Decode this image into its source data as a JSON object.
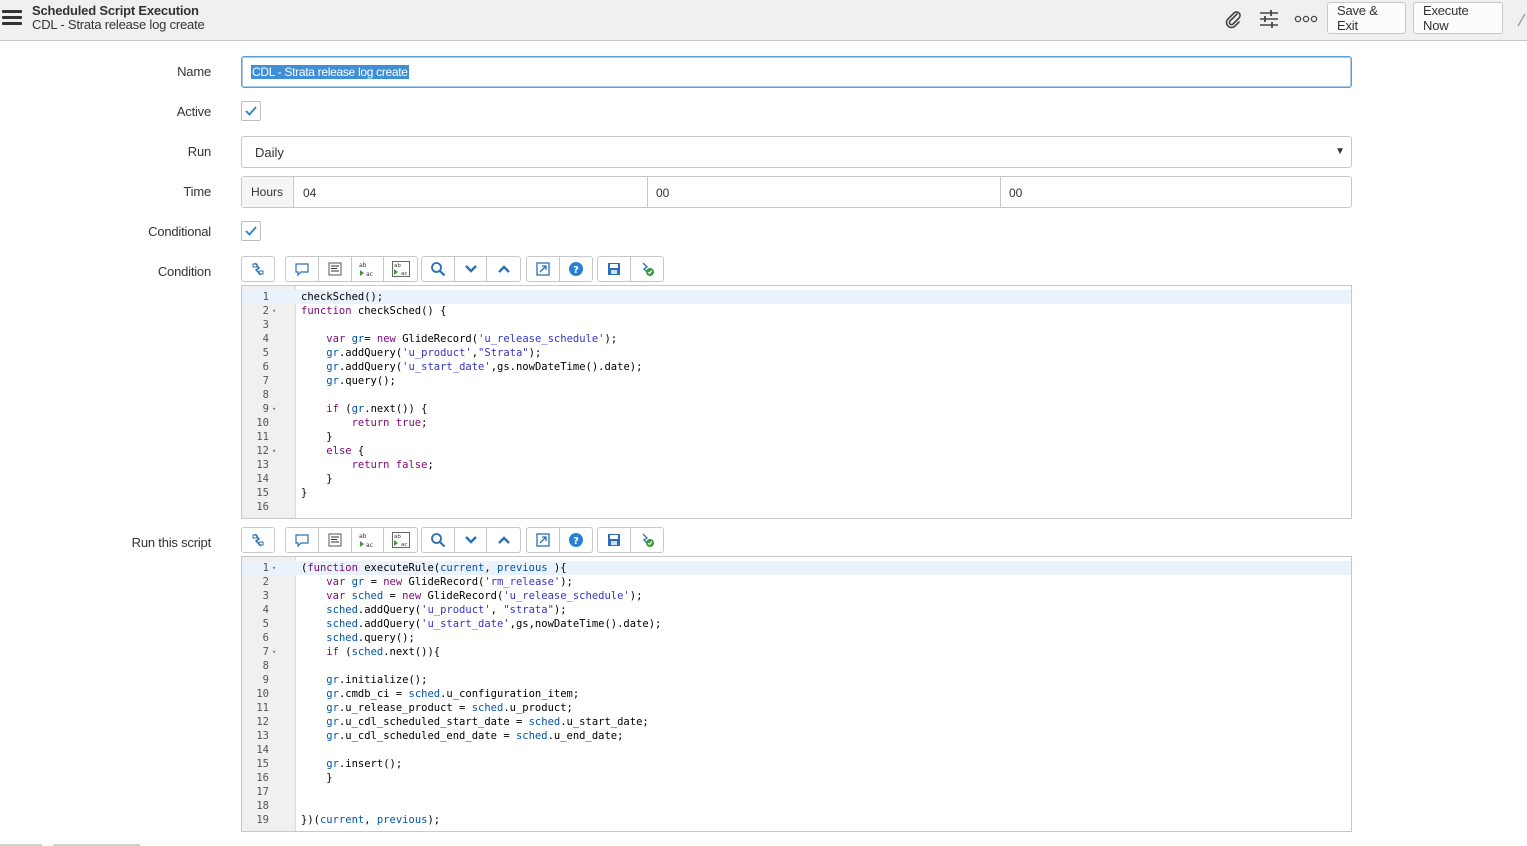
{
  "header": {
    "title": "Scheduled Script Execution",
    "subtitle": "CDL - Strata release log create",
    "buttons": {
      "save_exit": "Save & Exit",
      "execute_now": "Execute Now"
    },
    "icons": [
      "menu-icon",
      "paperclip-icon",
      "sliders-icon",
      "more-icon"
    ]
  },
  "form": {
    "name": {
      "label": "Name",
      "value": "CDL - Strata release log create"
    },
    "active": {
      "label": "Active",
      "checked": true
    },
    "run": {
      "label": "Run",
      "value": "Daily"
    },
    "time": {
      "label": "Time",
      "addon": "Hours",
      "hours": "04",
      "minutes": "00",
      "seconds": "00"
    },
    "conditional": {
      "label": "Conditional",
      "checked": true
    },
    "condition": {
      "label": "Condition"
    },
    "script": {
      "label": "Run this script"
    }
  },
  "toolbar_icons": [
    "toggle-syntax-icon",
    "comment-icon",
    "format-icon",
    "replace-icon",
    "replace-all-icon",
    "search-icon",
    "find-next-icon",
    "find-previous-icon",
    "fullscreen-icon",
    "help-icon",
    "save-icon",
    "script-debugger-icon"
  ],
  "condition_code": [
    {
      "n": "1",
      "fold": "",
      "text": "checkSched();"
    },
    {
      "n": "2",
      "fold": "▾",
      "text": "function checkSched() {"
    },
    {
      "n": "3",
      "fold": "",
      "text": ""
    },
    {
      "n": "4",
      "fold": "",
      "text": "    var gr= new GlideRecord('u_release_schedule');"
    },
    {
      "n": "5",
      "fold": "",
      "text": "    gr.addQuery('u_product',\"Strata\");"
    },
    {
      "n": "6",
      "fold": "",
      "text": "    gr.addQuery('u_start_date',gs.nowDateTime().date);"
    },
    {
      "n": "7",
      "fold": "",
      "text": "    gr.query();"
    },
    {
      "n": "8",
      "fold": "",
      "text": ""
    },
    {
      "n": "9",
      "fold": "▾",
      "text": "    if (gr.next()) {"
    },
    {
      "n": "10",
      "fold": "",
      "text": "        return true;"
    },
    {
      "n": "11",
      "fold": "",
      "text": "    }"
    },
    {
      "n": "12",
      "fold": "▾",
      "text": "    else {"
    },
    {
      "n": "13",
      "fold": "",
      "text": "        return false;"
    },
    {
      "n": "14",
      "fold": "",
      "text": "    }"
    },
    {
      "n": "15",
      "fold": "",
      "text": "}"
    },
    {
      "n": "16",
      "fold": "",
      "text": ""
    }
  ],
  "script_code": [
    {
      "n": "1",
      "fold": "▾",
      "text": "(function executeRule(current, previous ){"
    },
    {
      "n": "2",
      "fold": "",
      "text": "    var gr = new GlideRecord('rm_release');"
    },
    {
      "n": "3",
      "fold": "",
      "text": "    var sched = new GlideRecord('u_release_schedule');"
    },
    {
      "n": "4",
      "fold": "",
      "text": "    sched.addQuery('u_product', \"strata\");"
    },
    {
      "n": "5",
      "fold": "",
      "text": "    sched.addQuery('u_start_date',gs,nowDateTime().date);"
    },
    {
      "n": "6",
      "fold": "",
      "text": "    sched.query();"
    },
    {
      "n": "7",
      "fold": "▾",
      "text": "    if (sched.next()){"
    },
    {
      "n": "8",
      "fold": "",
      "text": ""
    },
    {
      "n": "9",
      "fold": "",
      "text": "    gr.initialize();"
    },
    {
      "n": "10",
      "fold": "",
      "text": "    gr.cmdb_ci = sched.u_configuration_item;"
    },
    {
      "n": "11",
      "fold": "",
      "text": "    gr.u_release_product = sched.u_product;"
    },
    {
      "n": "12",
      "fold": "",
      "text": "    gr.u_cdl_scheduled_start_date = sched.u_start_date;"
    },
    {
      "n": "13",
      "fold": "",
      "text": "    gr.u_cdl_scheduled_end_date = sched.u_end_date;"
    },
    {
      "n": "14",
      "fold": "",
      "text": ""
    },
    {
      "n": "15",
      "fold": "",
      "text": "    gr.insert();"
    },
    {
      "n": "16",
      "fold": "",
      "text": "    }"
    },
    {
      "n": "17",
      "fold": "",
      "text": ""
    },
    {
      "n": "18",
      "fold": "",
      "text": ""
    },
    {
      "n": "19",
      "fold": "",
      "text": "})(current, previous);"
    }
  ]
}
